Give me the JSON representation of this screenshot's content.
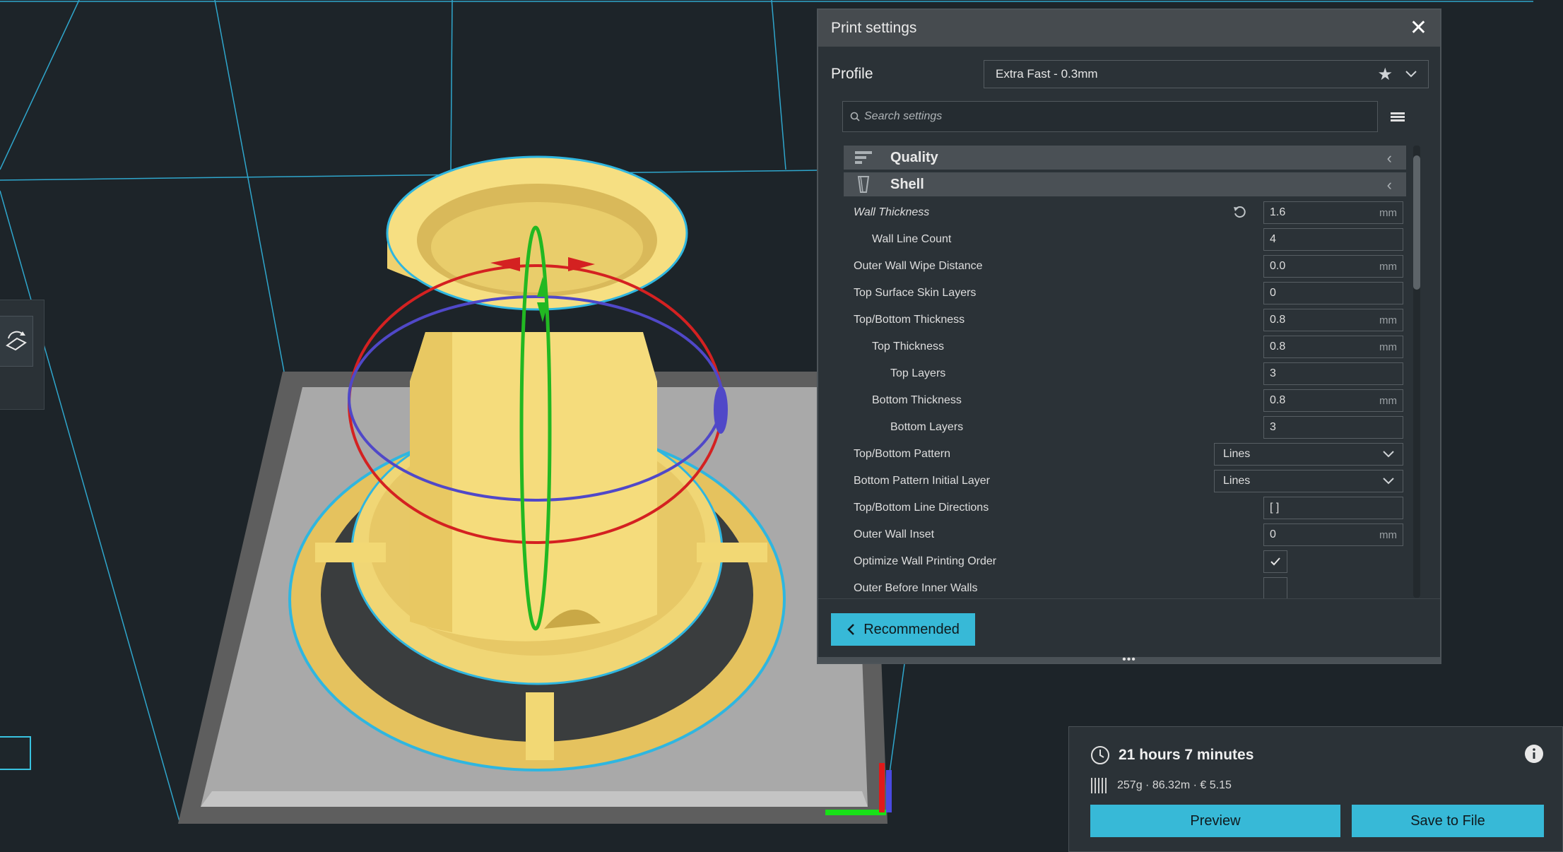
{
  "print_settings": {
    "title": "Print settings",
    "profile_label": "Profile",
    "profile_value": "Extra Fast - 0.3mm",
    "search_placeholder": "Search settings",
    "categories": [
      {
        "label": "Quality",
        "icon": "quality-icon"
      },
      {
        "label": "Shell",
        "icon": "shell-icon"
      }
    ],
    "settings": [
      {
        "label": "Wall Thickness",
        "value": "1.6",
        "unit": "mm"
      },
      {
        "label": "Wall Line Count",
        "value": "4",
        "unit": ""
      },
      {
        "label": "Outer Wall Wipe Distance",
        "value": "0.0",
        "unit": "mm"
      },
      {
        "label": "Top Surface Skin Layers",
        "value": "0",
        "unit": ""
      },
      {
        "label": "Top/Bottom Thickness",
        "value": "0.8",
        "unit": "mm"
      },
      {
        "label": "Top Thickness",
        "value": "0.8",
        "unit": "mm"
      },
      {
        "label": "Top Layers",
        "value": "3",
        "unit": ""
      },
      {
        "label": "Bottom Thickness",
        "value": "0.8",
        "unit": "mm"
      },
      {
        "label": "Bottom Layers",
        "value": "3",
        "unit": ""
      },
      {
        "label": "Top/Bottom Pattern",
        "value": "Lines"
      },
      {
        "label": "Bottom Pattern Initial Layer",
        "value": "Lines"
      },
      {
        "label": "Top/Bottom Line Directions",
        "value": "[ ]",
        "unit": ""
      },
      {
        "label": "Outer Wall Inset",
        "value": "0",
        "unit": "mm"
      },
      {
        "label": "Optimize Wall Printing Order",
        "checked": true
      },
      {
        "label": "Outer Before Inner Walls",
        "checked": false
      }
    ],
    "recommended_label": "Recommended"
  },
  "job": {
    "time": "21 hours 7 minutes",
    "stats": "257g · 86.32m · € 5.15",
    "preview_label": "Preview",
    "save_label": "Save to File"
  },
  "colors": {
    "accent": "#37b9d7",
    "model": "#f5dd7a",
    "background": "#1d2429",
    "rotate_x": "#d42121",
    "rotate_y": "#22b822",
    "rotate_z": "#5048c8"
  }
}
